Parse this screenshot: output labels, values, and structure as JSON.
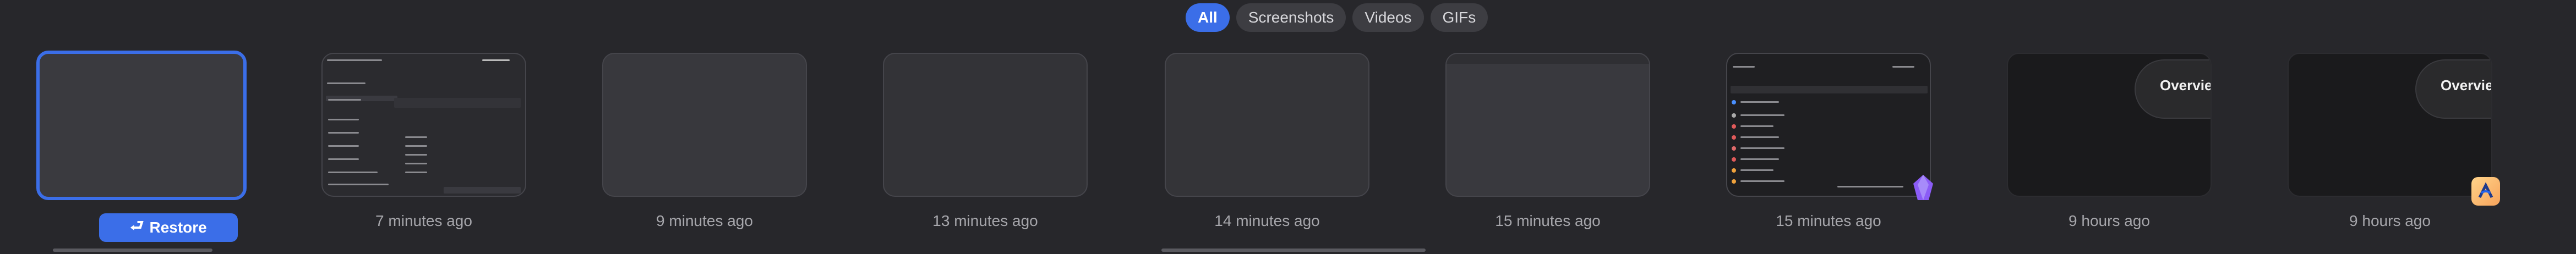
{
  "filters": {
    "all": "All",
    "screenshots": "Screenshots",
    "videos": "Videos",
    "gifs": "GIFs"
  },
  "restore_label": "Restore",
  "overview_label": "Overvie",
  "cards": [
    {
      "time": ""
    },
    {
      "time": "7 minutes ago"
    },
    {
      "time": "9 minutes ago"
    },
    {
      "time": "13 minutes ago"
    },
    {
      "time": "14 minutes ago"
    },
    {
      "time": "15 minutes ago"
    },
    {
      "time": "15 minutes ago"
    },
    {
      "time": "9 hours ago"
    },
    {
      "time": "9 hours ago"
    }
  ],
  "colors": {
    "accent": "#3b6ee8",
    "background": "#27272b"
  }
}
